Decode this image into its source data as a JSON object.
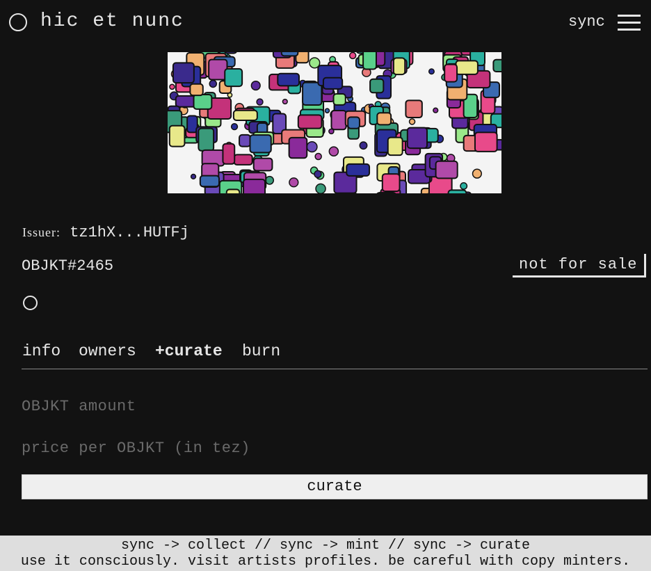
{
  "header": {
    "logo_icon": "circle-logo-icon",
    "title": "hic et nunc",
    "sync_label": "sync",
    "menu_icon": "hamburger-menu-icon"
  },
  "token": {
    "issuer_label": "Issuer:",
    "issuer_address": "tz1hX...HUTFj",
    "objkt_id": "OBJKT#2465",
    "sale_status": "not for sale",
    "token_icon": "circle-icon"
  },
  "tabs": [
    {
      "label": "info",
      "active": false
    },
    {
      "label": "owners",
      "active": false
    },
    {
      "label": "+curate",
      "active": true
    },
    {
      "label": "burn",
      "active": false
    }
  ],
  "form": {
    "amount_placeholder": "OBJKT amount",
    "amount_value": "",
    "price_placeholder": "price per OBJKT (in tez)",
    "price_value": "",
    "submit_label": "curate"
  },
  "footer": {
    "line1": "sync -> collect // sync -> mint // sync -> curate",
    "line2": "use it consciously. visit artists profiles. be careful with copy minters."
  },
  "colors": {
    "background": "#121212",
    "text": "#e6e6e6",
    "placeholder": "#6a6a6a",
    "button_bg": "#efefef",
    "footer_bg": "#dedede"
  }
}
